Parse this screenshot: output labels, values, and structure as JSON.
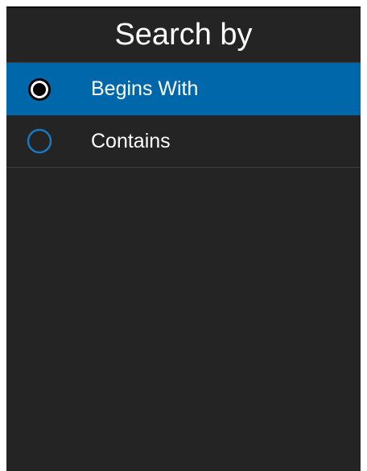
{
  "header": {
    "title": "Search by"
  },
  "options": [
    {
      "label": "Begins With",
      "selected": true,
      "icon": "radio-selected-icon"
    },
    {
      "label": "Contains",
      "selected": false,
      "icon": "radio-unselected-icon"
    }
  ],
  "colors": {
    "background": "#242424",
    "selected_row": "#0067aa",
    "radio_ring": "#1a78c2",
    "text": "#ffffff",
    "divider": "#3e3e3e"
  }
}
